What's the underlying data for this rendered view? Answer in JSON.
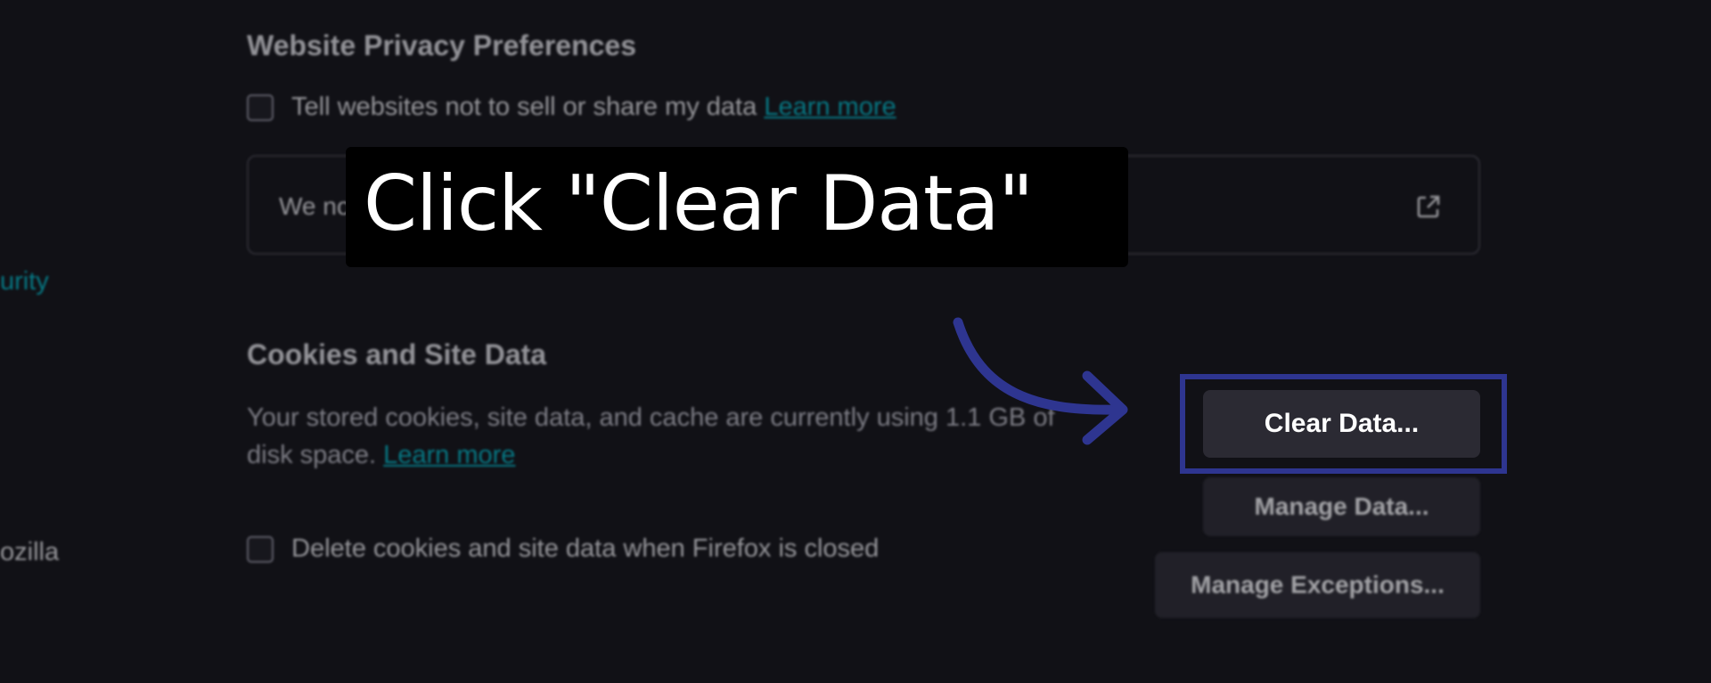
{
  "sidebar": {
    "security_label": "urity",
    "mozilla_label": "ozilla"
  },
  "privacy": {
    "title": "Website Privacy Preferences",
    "gpc_label": "Tell websites not to sell or share my data",
    "gpc_link": "Learn more",
    "notice_text": "We no"
  },
  "cookies": {
    "title": "Cookies and Site Data",
    "description": "Your stored cookies, site data, and cache are currently using 1.1 GB of",
    "description_line2": "disk space.",
    "learn_more": "Learn more",
    "delete_label": "Delete cookies and site data when Firefox is closed"
  },
  "buttons": {
    "clear_data": "Clear Data...",
    "manage_data": "Manage Data...",
    "manage_exceptions": "Manage Exceptions..."
  },
  "callout": {
    "text": "Click \"Clear Data\""
  },
  "colors": {
    "accent": "#00b6c6",
    "highlight": "#2e3590",
    "background": "#111116"
  },
  "icons": {
    "external_link": "external-link-icon",
    "arrow": "arrow-icon"
  }
}
